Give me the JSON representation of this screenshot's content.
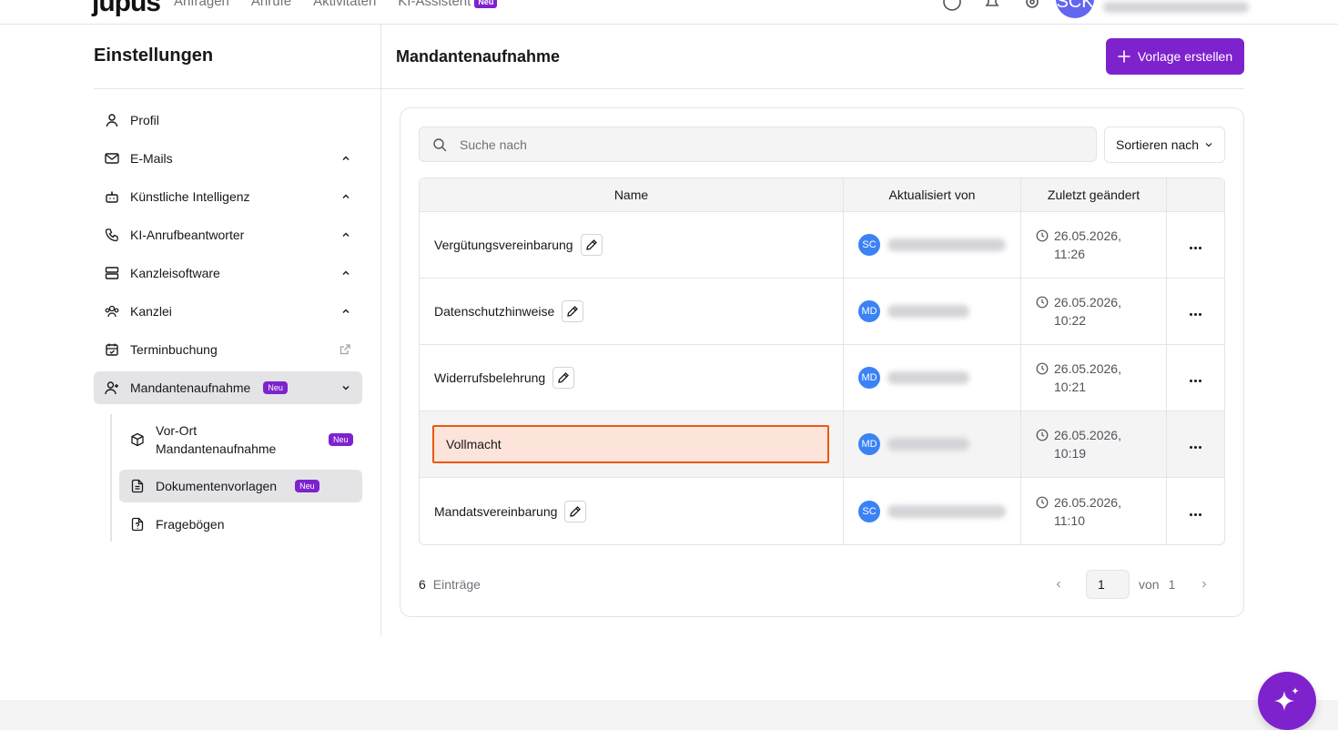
{
  "topbar": {
    "logo": "jupus",
    "nav": [
      "Anfragen",
      "Anrufe",
      "Aktivitäten",
      "KI-Assistent"
    ],
    "nav_badge": "Neu",
    "avatar_initials": "SCK"
  },
  "sidebar": {
    "title": "Einstellungen",
    "items": [
      {
        "label": "Profil",
        "icon": "user-icon"
      },
      {
        "label": "E-Mails",
        "icon": "mail-icon"
      },
      {
        "label": "Künstliche Intelligenz",
        "icon": "bot-icon"
      },
      {
        "label": "KI-Anrufbeantworter",
        "icon": "phone-icon"
      },
      {
        "label": "Kanzleisoftware",
        "icon": "server-icon"
      },
      {
        "label": "Kanzlei",
        "icon": "users-icon"
      },
      {
        "label": "Terminbuchung",
        "icon": "calendar-icon"
      },
      {
        "label": "Mandantenaufnahme",
        "icon": "user-plus-icon",
        "badge": "Neu"
      }
    ],
    "subitems": [
      {
        "label": "Vor-Ort Mandantenaufnahme",
        "badge": "Neu",
        "icon": "box-icon"
      },
      {
        "label": "Dokumentenvorlagen",
        "badge": "Neu",
        "icon": "file-text-icon"
      },
      {
        "label": "Fragebögen",
        "icon": "file-question-icon"
      }
    ]
  },
  "main": {
    "title": "Mandantenaufnahme",
    "create_button": "Vorlage erstellen",
    "search_placeholder": "Suche nach",
    "sort_label": "Sortieren nach",
    "columns": [
      "Name",
      "Aktualisiert von",
      "Zuletzt geändert"
    ],
    "rows": [
      {
        "name": "Vergütungsvereinbarung",
        "initials": "SC",
        "date": "26.05.2026,",
        "time": "11:26"
      },
      {
        "name": "Datenschutzhinweise",
        "initials": "MD",
        "date": "26.05.2026,",
        "time": "10:22"
      },
      {
        "name": "Widerrufsbelehrung",
        "initials": "MD",
        "date": "26.05.2026,",
        "time": "10:21"
      },
      {
        "name": "Vollmacht",
        "initials": "MD",
        "date": "26.05.2026,",
        "time": "10:19"
      },
      {
        "name": "Mandatsvereinbarung",
        "initials": "SC",
        "date": "26.05.2026,",
        "time": "11:10"
      }
    ],
    "entries_count": "6",
    "entries_label": "Einträge",
    "page_current": "1",
    "page_of": "von",
    "page_total": "1"
  },
  "colors": {
    "accent": "#7e22ce",
    "avatar": "#3b82f6",
    "edit_border": "#ea580c",
    "edit_bg": "#fde4da"
  }
}
